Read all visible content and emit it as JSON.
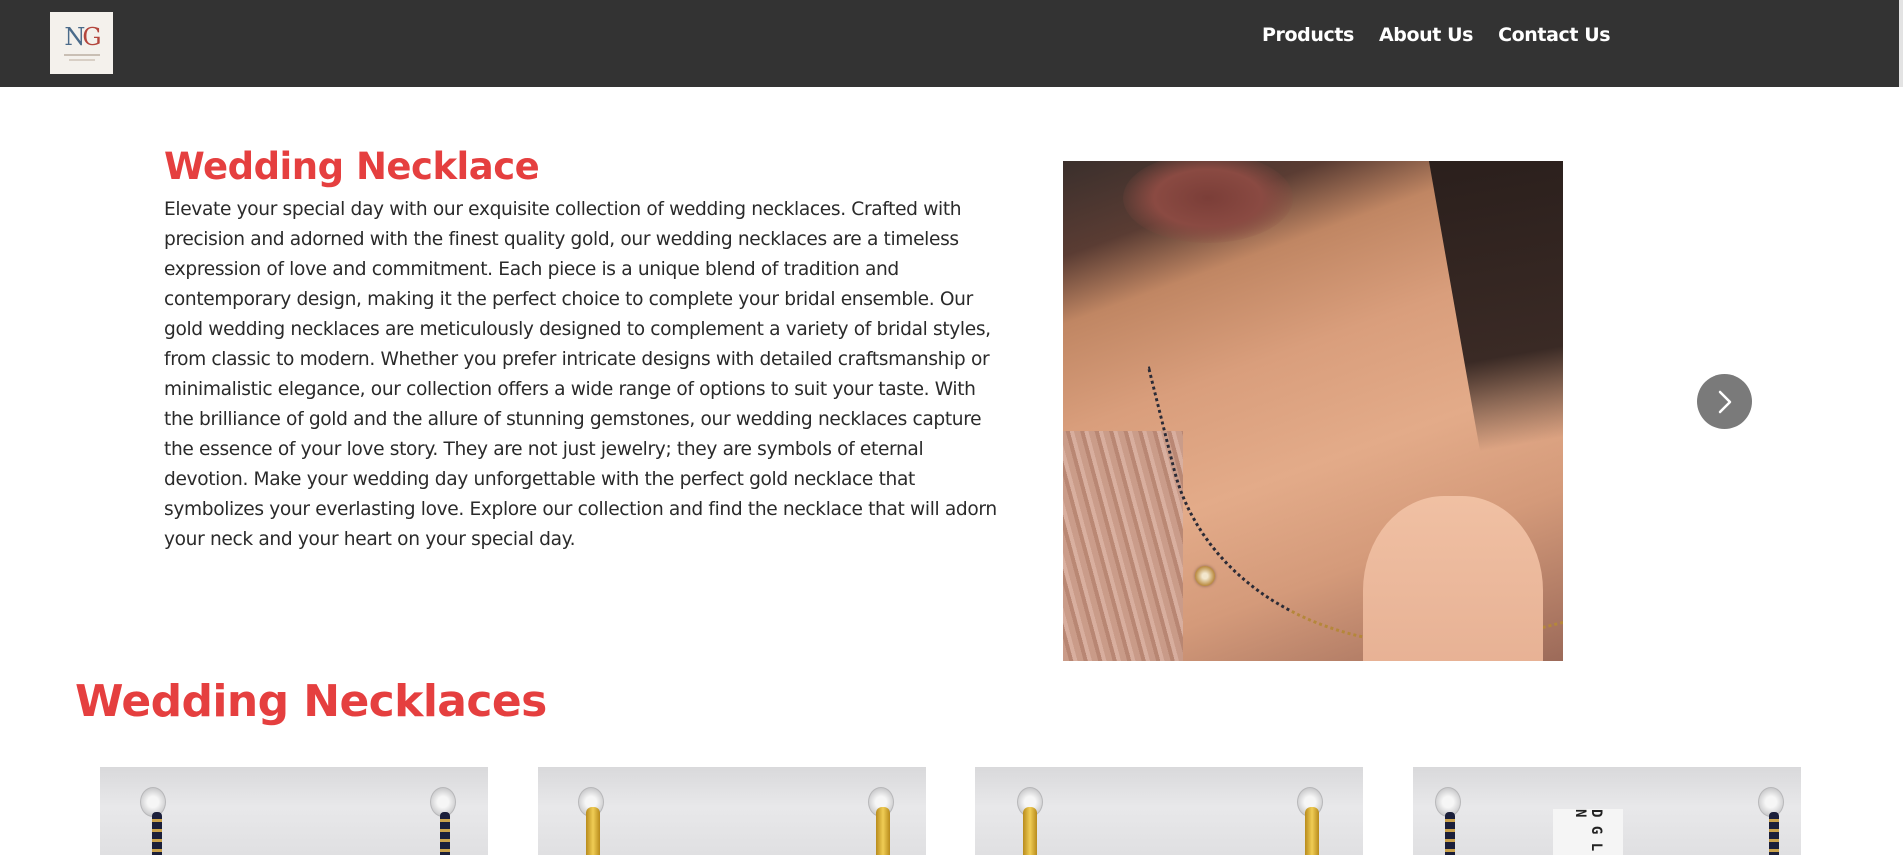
{
  "header": {
    "logo_alt": "NG",
    "nav": [
      {
        "label": "Products"
      },
      {
        "label": "About Us"
      },
      {
        "label": "Contact Us"
      }
    ]
  },
  "hero": {
    "title": "Wedding Necklace",
    "description": "Elevate your special day with our exquisite collection of wedding necklaces. Crafted with precision and adorned with the finest quality gold, our wedding necklaces are a timeless expression of love and commitment. Each piece is a unique blend of tradition and contemporary design, making it the perfect choice to complete your bridal ensemble. Our gold wedding necklaces are meticulously designed to complement a variety of bridal styles, from classic to modern. Whether you prefer intricate designs with detailed craftsmanship or minimalistic elegance, our collection offers a wide range of options to suit your taste. With the brilliance of gold and the allure of stunning gemstones, our wedding necklaces capture the essence of your love story. They are not just jewelry; they are symbols of eternal devotion. Make your wedding day unforgettable with the perfect gold necklace that symbolizes your everlasting love. Explore our collection and find the necklace that will adorn your neck and your heart on your special day.",
    "next_icon": "chevron-right-icon"
  },
  "section": {
    "title": "Wedding Necklaces",
    "products": [
      {
        "style": "black-beads"
      },
      {
        "style": "gold"
      },
      {
        "style": "gold"
      },
      {
        "style": "black-beads-tagged",
        "tag_text": "D G L N"
      }
    ]
  },
  "colors": {
    "header_bg": "#333333",
    "accent": "#e53f3f",
    "nav_text": "#ffffff",
    "carousel_button": "#7a7a7a"
  }
}
